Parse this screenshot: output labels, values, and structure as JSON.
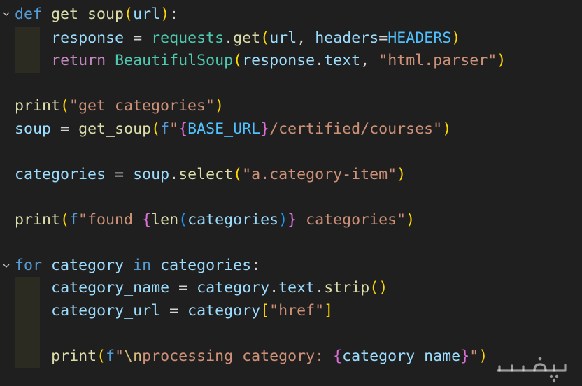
{
  "editor": {
    "language": "python",
    "theme": "dark",
    "colors": {
      "background": "#1f1f1f",
      "keyword": "#569cd6",
      "control_keyword": "#c586c0",
      "function": "#dcdcaa",
      "variable": "#9cdcfe",
      "class": "#4ec9b0",
      "constant": "#4fc1ff",
      "string": "#ce9178",
      "bracket_1": "#ffd700",
      "bracket_2": "#da70d6",
      "bracket_3": "#179fff"
    },
    "lines": [
      "def get_soup(url):",
      "    response = requests.get(url, headers=HEADERS)",
      "    return BeautifulSoup(response.text, \"html.parser\")",
      "",
      "print(\"get categories\")",
      "soup = get_soup(f\"{BASE_URL}/certified/courses\")",
      "",
      "categories = soup.select(\"a.category-item\")",
      "",
      "print(f\"found {len(categories)} categories\")",
      "",
      "for category in categories:",
      "    category_name = category.text.strip()",
      "    category_url = category[\"href\"]",
      "",
      "    print(f\"\\nprocessing category: {category_name}\")"
    ]
  },
  "watermark": {
    "icon": "khamsat-logo"
  }
}
